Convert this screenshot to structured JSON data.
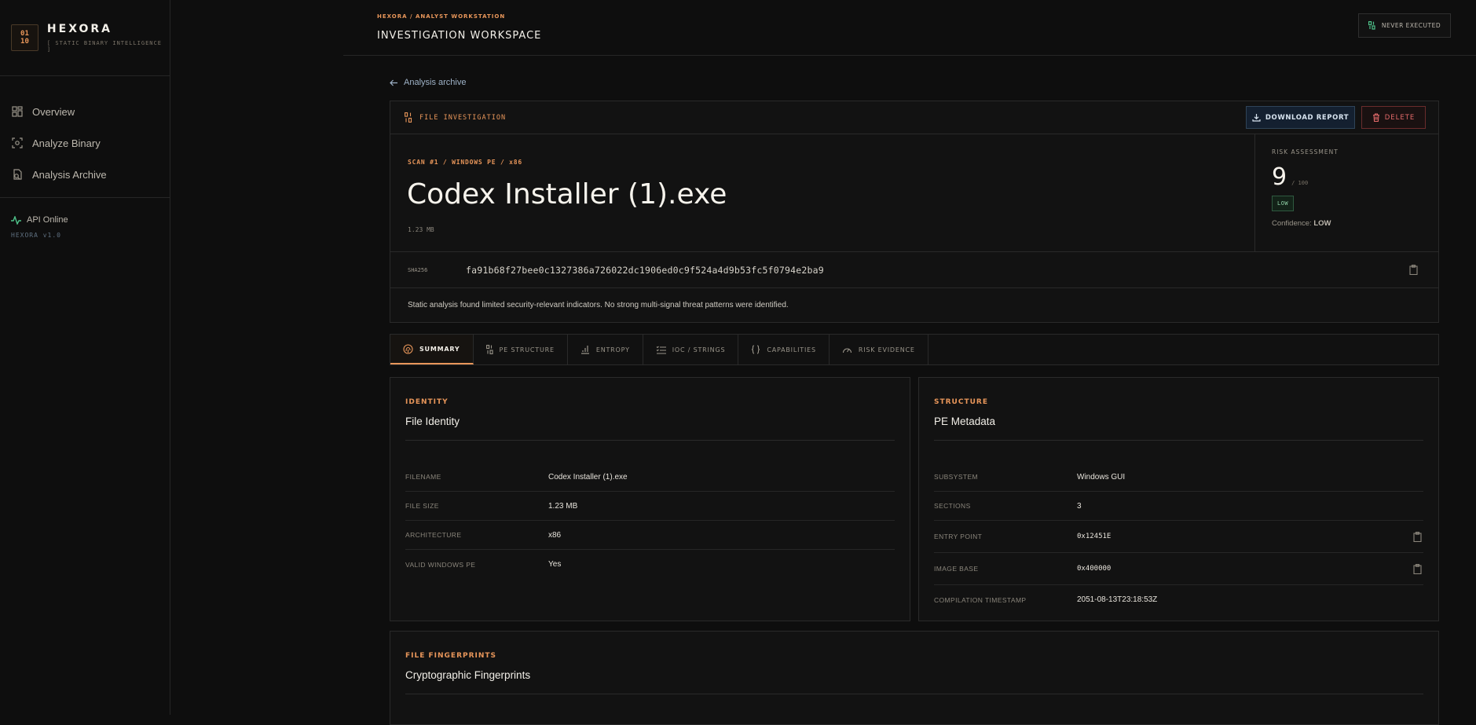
{
  "brand": {
    "logo": "01\n10",
    "name": "HEXORA",
    "subtitle": "[ STATIC BINARY INTELLIGENCE ]"
  },
  "sidebar": {
    "items": [
      {
        "label": "Overview",
        "icon": "grid-icon"
      },
      {
        "label": "Analyze Binary",
        "icon": "scan-icon"
      },
      {
        "label": "Analysis Archive",
        "icon": "archive-icon"
      }
    ],
    "api_status": "API Online",
    "version": "HEXORA v1.0"
  },
  "topbar": {
    "breadcrumb": "HEXORA / ANALYST WORKSTATION",
    "title": "INVESTIGATION WORKSPACE",
    "execution_status": "NEVER EXECUTED"
  },
  "back_link": "Analysis archive",
  "file_card": {
    "header_label": "FILE INVESTIGATION",
    "download_label": "DOWNLOAD REPORT",
    "delete_label": "DELETE",
    "scan_line": "SCAN #1 / WINDOWS PE / x86",
    "file_name": "Codex Installer (1).exe",
    "file_size": "1.23 MB",
    "risk": {
      "label": "RISK ASSESSMENT",
      "score": "9",
      "max": "/ 100",
      "level": "LOW",
      "confidence_label": "Confidence:",
      "confidence_value": "LOW"
    },
    "hash_label": "SHA256",
    "hash_value": "fa91b68f27bee0c1327386a726022dc1906ed0c9f524a4d9b53fc5f0794e2ba9",
    "note": "Static analysis found limited security-relevant indicators. No strong multi-signal threat patterns were identified."
  },
  "tabs": [
    {
      "label": "SUMMARY",
      "active": true
    },
    {
      "label": "PE STRUCTURE",
      "active": false
    },
    {
      "label": "ENTROPY",
      "active": false
    },
    {
      "label": "IOC / STRINGS",
      "active": false
    },
    {
      "label": "CAPABILITIES",
      "active": false
    },
    {
      "label": "RISK EVIDENCE",
      "active": false
    }
  ],
  "identity": {
    "eyebrow": "IDENTITY",
    "title": "File Identity",
    "rows": [
      {
        "key": "FILENAME",
        "value": "Codex Installer (1).exe"
      },
      {
        "key": "FILE SIZE",
        "value": "1.23 MB"
      },
      {
        "key": "ARCHITECTURE",
        "value": "x86"
      },
      {
        "key": "VALID WINDOWS PE",
        "value": "Yes"
      }
    ]
  },
  "structure": {
    "eyebrow": "STRUCTURE",
    "title": "PE Metadata",
    "rows": [
      {
        "key": "SUBSYSTEM",
        "value": "Windows GUI"
      },
      {
        "key": "SECTIONS",
        "value": "3"
      },
      {
        "key": "ENTRY POINT",
        "value": "0x12451E"
      },
      {
        "key": "IMAGE BASE",
        "value": "0x400000"
      },
      {
        "key": "COMPILATION TIMESTAMP",
        "value": "2051-08-13T23:18:53Z"
      }
    ]
  },
  "fingerprints": {
    "eyebrow": "FILE FINGERPRINTS",
    "title": "Cryptographic Fingerprints"
  },
  "colors": {
    "accent": "#e8965a",
    "background": "#0e0e0e",
    "panel": "#121212",
    "danger": "#e46a6a",
    "success": "#8fd0a6"
  }
}
